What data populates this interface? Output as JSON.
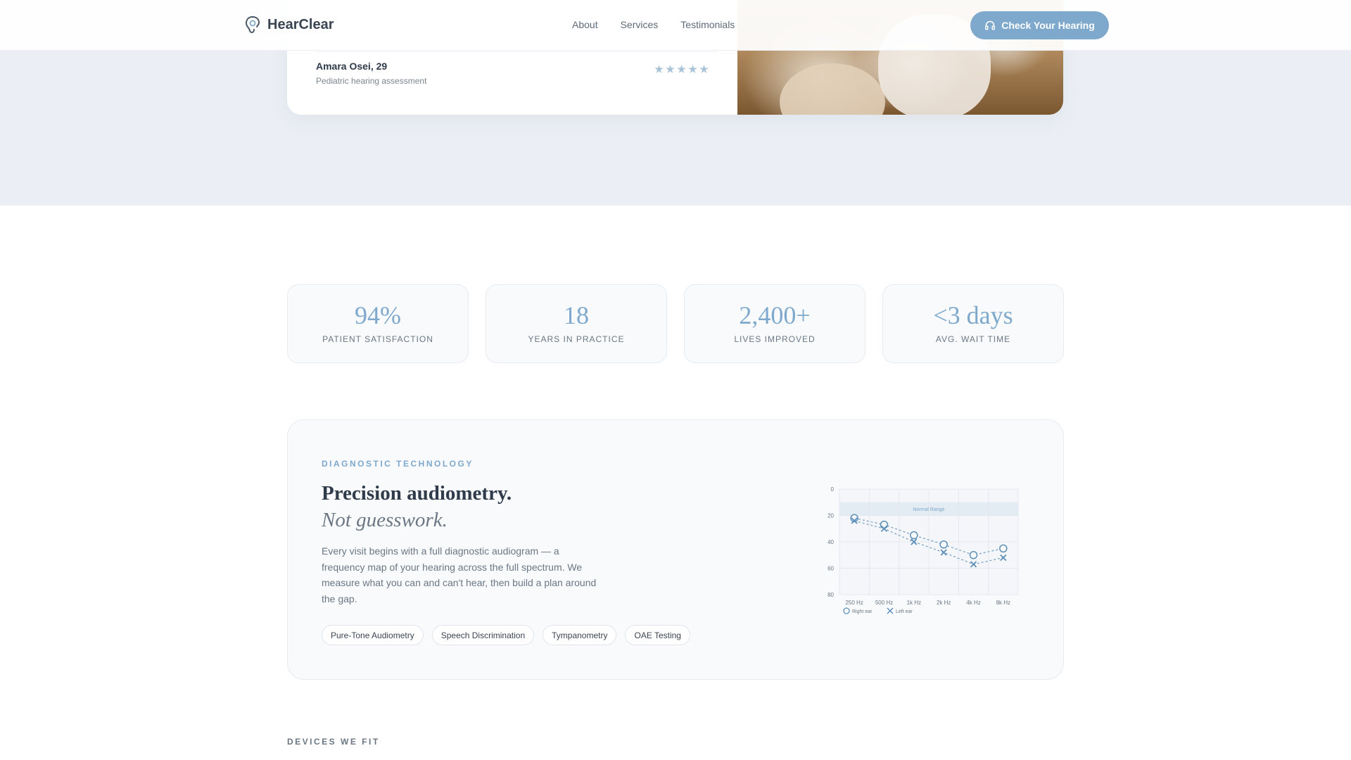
{
  "nav": {
    "brand": "HearClear",
    "links": [
      {
        "label": "About"
      },
      {
        "label": "Services"
      },
      {
        "label": "Testimonials"
      }
    ],
    "cta_label": "Check Your Hearing"
  },
  "testimonial": {
    "name": "Amara Osei, 29",
    "service": "Pediatric hearing assessment",
    "rating": 5
  },
  "stats": [
    {
      "value": "94%",
      "label": "PATIENT SATISFACTION"
    },
    {
      "value": "18",
      "label": "YEARS IN PRACTICE"
    },
    {
      "value": "2,400+",
      "label": "LIVES IMPROVED"
    },
    {
      "value": "<3 days",
      "label": "AVG. WAIT TIME"
    }
  ],
  "diagnostic": {
    "eyebrow": "DIAGNOSTIC TECHNOLOGY",
    "title": "Precision audiometry.",
    "title_italic": "Not guesswork.",
    "body": "Every visit begins with a full diagnostic audiogram — a frequency map of your hearing across the full spectrum. We measure what you can and can't hear, then build a plan around the gap.",
    "chips": [
      "Pure-Tone Audiometry",
      "Speech Discrimination",
      "Tympanometry",
      "OAE Testing"
    ]
  },
  "chart_data": {
    "type": "line",
    "categories": [
      "250 Hz",
      "500 Hz",
      "1k Hz",
      "2k Hz",
      "4k Hz",
      "8k Hz"
    ],
    "y_ticks": [
      "0",
      "20",
      "40",
      "60",
      "80"
    ],
    "ylim": [
      0,
      80
    ],
    "y_inverted": true,
    "band": {
      "label": "Normal Range",
      "from": 10,
      "to": 20
    },
    "series": [
      {
        "name": "Right ear",
        "marker": "circle",
        "values": [
          22,
          27,
          35,
          42,
          50,
          45
        ]
      },
      {
        "name": "Left ear",
        "marker": "x",
        "values": [
          24,
          30,
          40,
          48,
          57,
          52
        ]
      }
    ],
    "grid": true,
    "legend": "bottom-left",
    "color": "#5e8fb8"
  },
  "devices": {
    "eyebrow": "DEVICES WE FIT"
  },
  "colors": {
    "accent": "#7fa9cc",
    "band_bg": "#ebeff5",
    "text": "#2f3b4a"
  }
}
